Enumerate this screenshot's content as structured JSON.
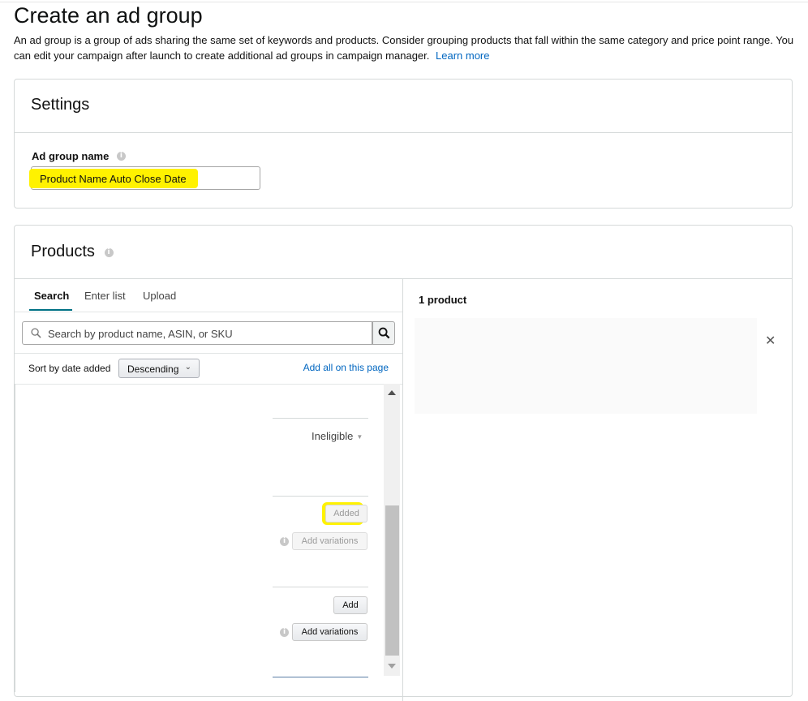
{
  "page": {
    "title": "Create an ad group",
    "intro_text": "An ad group is a group of ads sharing the same set of keywords and products. Consider grouping products that fall within the same category and price point range. You can edit your campaign after launch to create additional ad groups in campaign manager.",
    "learn_more": "Learn more"
  },
  "settings": {
    "title": "Settings",
    "ad_group_name_label": "Ad group name",
    "ad_group_name_value": "Product Name Auto Close Date"
  },
  "products": {
    "title": "Products",
    "tabs": [
      {
        "label": "Search",
        "active": true
      },
      {
        "label": "Enter list",
        "active": false
      },
      {
        "label": "Upload",
        "active": false
      }
    ],
    "search_placeholder": "Search by product name, ASIN, or SKU",
    "sort_label": "Sort by date added",
    "sort_value": "Descending",
    "add_all_link": "Add all on this page",
    "rows": [
      {
        "status": "Ineligible"
      },
      {
        "primary_button": "Added",
        "primary_disabled": true,
        "variations_button": "Add variations",
        "variations_disabled": true
      },
      {
        "primary_button": "Add",
        "primary_disabled": false,
        "variations_button": "Add variations",
        "variations_disabled": false
      }
    ],
    "selected_count_label": "1 product"
  },
  "colors": {
    "highlight": "#fff200",
    "link": "#0066c0",
    "tab_underline": "#007185"
  },
  "icons": [
    "info-icon",
    "search-icon",
    "chevron-down-icon",
    "close-icon",
    "scroll-up-arrow",
    "scroll-down-arrow"
  ]
}
